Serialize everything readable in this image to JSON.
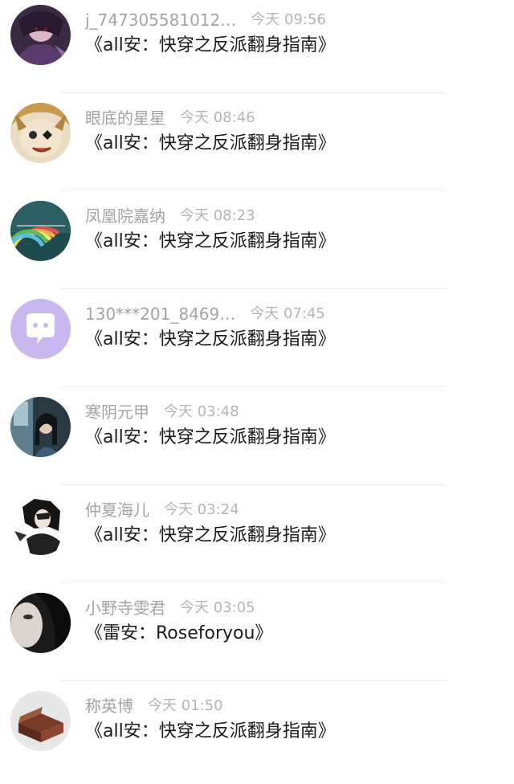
{
  "feed": {
    "items": [
      {
        "user": "j_747305581012…",
        "time": "今天 09:56",
        "text": "《all安：快穿之反派翻身指南》",
        "avatar": "dark-anime-avatar"
      },
      {
        "user": "眼底的星星",
        "time": "今天 08:46",
        "text": "《all安：快穿之反派翻身指南》",
        "avatar": "blonde-anime-avatar"
      },
      {
        "user": "凤凰院嘉纳",
        "time": "今天 08:23",
        "text": "《all安：快穿之反派翻身指南》",
        "avatar": "rainbow-avatar"
      },
      {
        "user": "130***201_8469…",
        "time": "今天 07:45",
        "text": "《all安：快穿之反派翻身指南》",
        "avatar": "chat-bubble-default-avatar"
      },
      {
        "user": "寒阴元甲",
        "time": "今天 03:48",
        "text": "《all安：快穿之反派翻身指南》",
        "avatar": "girl-window-avatar"
      },
      {
        "user": "仲夏海儿",
        "time": "今天 03:24",
        "text": "《all安：快穿之反派翻身指南》",
        "avatar": "dark-hair-anime-avatar"
      },
      {
        "user": "小野寺雯君",
        "time": "今天 03:05",
        "text": "《雷安：Roseforyou》",
        "avatar": "face-closeup-avatar"
      },
      {
        "user": "称英博",
        "time": "今天 01:50",
        "text": "《all安：快穿之反派翻身指南》",
        "avatar": "brown-box-avatar"
      }
    ]
  },
  "colors": {
    "username": "#a3a3a3",
    "timestamp": "#b5b5b5",
    "message": "#1a1a1a",
    "divider": "#ededed",
    "default_avatar": "#c9b8f0"
  }
}
